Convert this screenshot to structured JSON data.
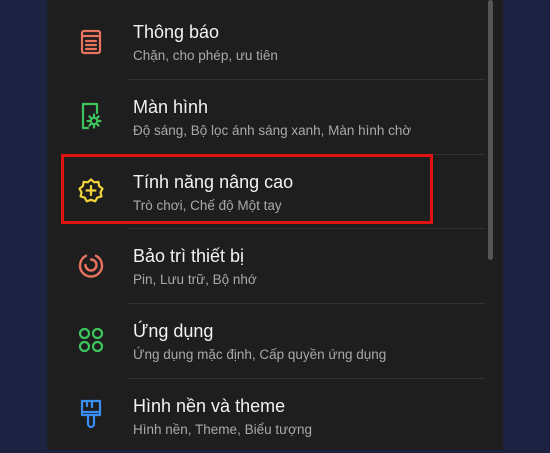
{
  "settings_list": {
    "items": [
      {
        "title": "Thông báo",
        "subtitle": "Chặn, cho phép, ưu tiên",
        "icon": "notification-icon",
        "icon_color": "#e8735f"
      },
      {
        "title": "Màn hình",
        "subtitle": "Độ sáng, Bộ lọc ánh sáng xanh, Màn hình chờ",
        "icon": "display-gear-icon",
        "icon_color": "#3ec45c"
      },
      {
        "title": "Tính năng nâng cao",
        "subtitle": "Trò chơi, Chế độ Một tay",
        "icon": "advanced-features-icon",
        "icon_color": "#f2d33a"
      },
      {
        "title": "Bảo trì thiết bị",
        "subtitle": "Pin, Lưu trữ, Bộ nhớ",
        "icon": "device-care-icon",
        "icon_color": "#e8735f"
      },
      {
        "title": "Ứng dụng",
        "subtitle": "Ứng dụng mặc định, Cấp quyền ứng dụng",
        "icon": "apps-icon",
        "icon_color": "#3ec45c"
      },
      {
        "title": "Hình nền và theme",
        "subtitle": "Hình nền, Theme, Biểu tượng",
        "icon": "paint-brush-icon",
        "icon_color": "#3a8ef2"
      }
    ]
  },
  "colors": {
    "highlight_border": "#e01212",
    "background": "#1e1e1e",
    "title_text": "#f2f2f2",
    "subtitle_text": "#a9a9a9"
  }
}
